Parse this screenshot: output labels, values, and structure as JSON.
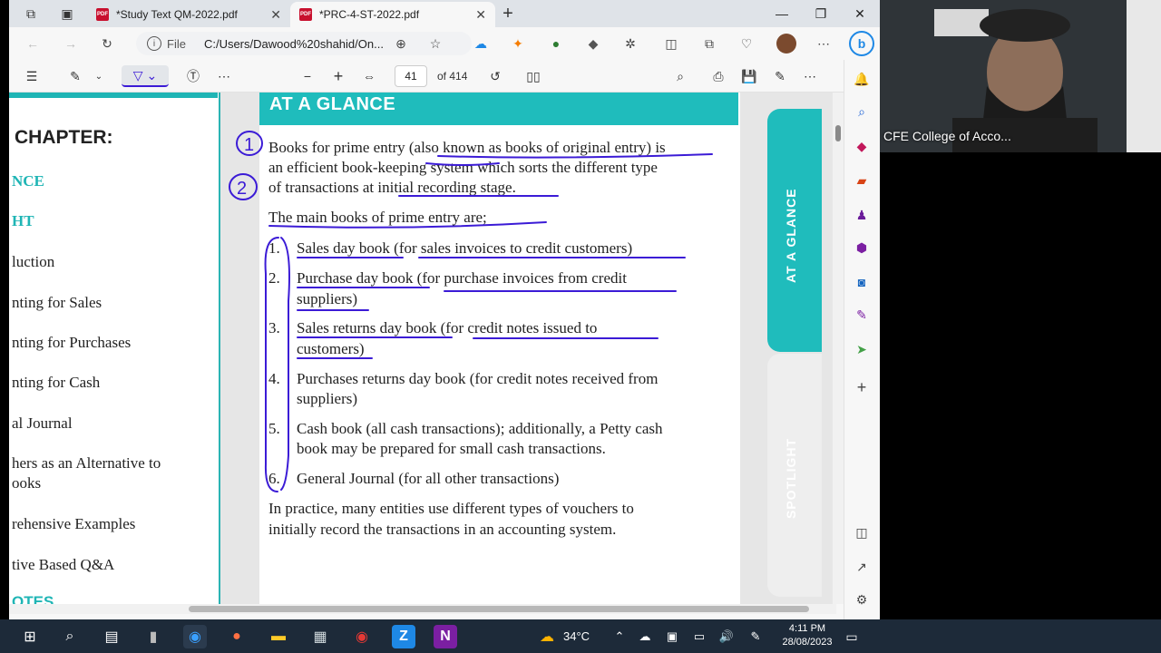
{
  "browser": {
    "tabs": [
      {
        "title": "*Study Text QM-2022.pdf",
        "active": false
      },
      {
        "title": "*PRC-4-ST-2022.pdf",
        "active": true
      }
    ],
    "address": {
      "scheme_label": "File",
      "url": "C:/Users/Dawood%20shahid/On..."
    },
    "pdf_toolbar": {
      "page_current": "41",
      "page_total": "of 414"
    }
  },
  "left_page": {
    "items": [
      "CHAPTER:",
      "NCE",
      "HT",
      "luction",
      "nting for Sales",
      "nting for Purchases",
      "nting for Cash",
      "al Journal",
      "hers as an Alternative to",
      "ooks",
      "rehensive Examples",
      "tive Based Q&A",
      "OTES"
    ]
  },
  "main_page": {
    "header": "AT A GLANCE",
    "intro_lines": [
      "Books for prime entry (also known as books of original entry) is",
      "an efficient book-keeping system which sorts the different type",
      "of transactions at initial recording stage."
    ],
    "list_heading": "The main books of prime entry are;",
    "list": [
      {
        "num": "1.",
        "lines": [
          "Sales day book (for sales invoices to credit customers)"
        ]
      },
      {
        "num": "2.",
        "lines": [
          "Purchase day book (for purchase invoices from credit",
          "suppliers)"
        ]
      },
      {
        "num": "3.",
        "lines": [
          "Sales returns day book (for credit notes issued to",
          "customers)"
        ]
      },
      {
        "num": "4.",
        "lines": [
          "Purchases returns day book (for credit notes received from",
          "suppliers)"
        ]
      },
      {
        "num": "5.",
        "lines": [
          "Cash book (all cash transactions); additionally, a Petty cash",
          "book may be prepared for small cash transactions."
        ]
      },
      {
        "num": "6.",
        "lines": [
          "General Journal (for all other transactions)"
        ]
      }
    ],
    "closing_lines": [
      "In practice, many entities use different types of vouchers to",
      "initially record the transactions in an accounting system."
    ],
    "annotations": [
      "1",
      "2"
    ]
  },
  "side_tabs": {
    "glance": "AT A GLANCE",
    "spotlight": "SPOTLIGHT"
  },
  "webcam": {
    "name": "CFE College of Acco..."
  },
  "taskbar": {
    "temperature": "34°C",
    "time": "4:11 PM",
    "date": "28/08/2023"
  },
  "colors": {
    "teal": "#1fbcbc",
    "ink": "#3b1bd6",
    "taskbar": "#1d2a39"
  }
}
